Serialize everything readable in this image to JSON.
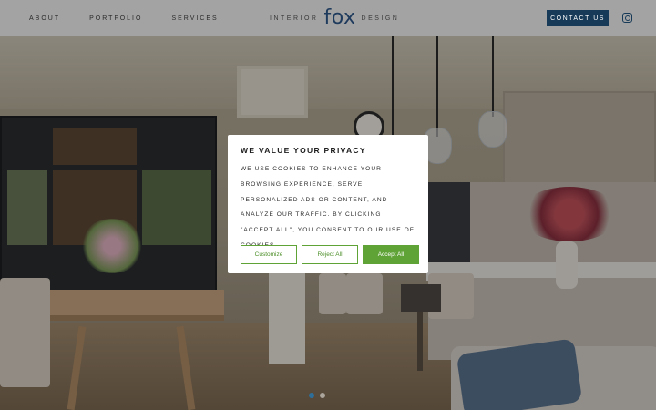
{
  "nav": {
    "about": "ABOUT",
    "portfolio": "PORTFOLIO",
    "services": "SERVICES"
  },
  "logo": {
    "left": "INTERIOR",
    "brand": "fox",
    "right": "DESIGN"
  },
  "header": {
    "contact_label": "CONTACT US",
    "social_icon": "instagram-icon"
  },
  "cookie": {
    "title": "WE VALUE YOUR PRIVACY",
    "body": "WE USE COOKIES TO ENHANCE YOUR BROWSING EXPERIENCE, SERVE PERSONALIZED ADS OR CONTENT, AND ANALYZE OUR TRAFFIC. BY CLICKING \"ACCEPT ALL\", YOU CONSENT TO OUR USE OF COOKIES.",
    "customize_label": "Customize",
    "reject_label": "Reject All",
    "accept_label": "Accept All"
  },
  "slider": {
    "dots": 2,
    "active_index": 0
  },
  "colors": {
    "brand_navy": "#163a57",
    "accept_green": "#5fa336"
  }
}
